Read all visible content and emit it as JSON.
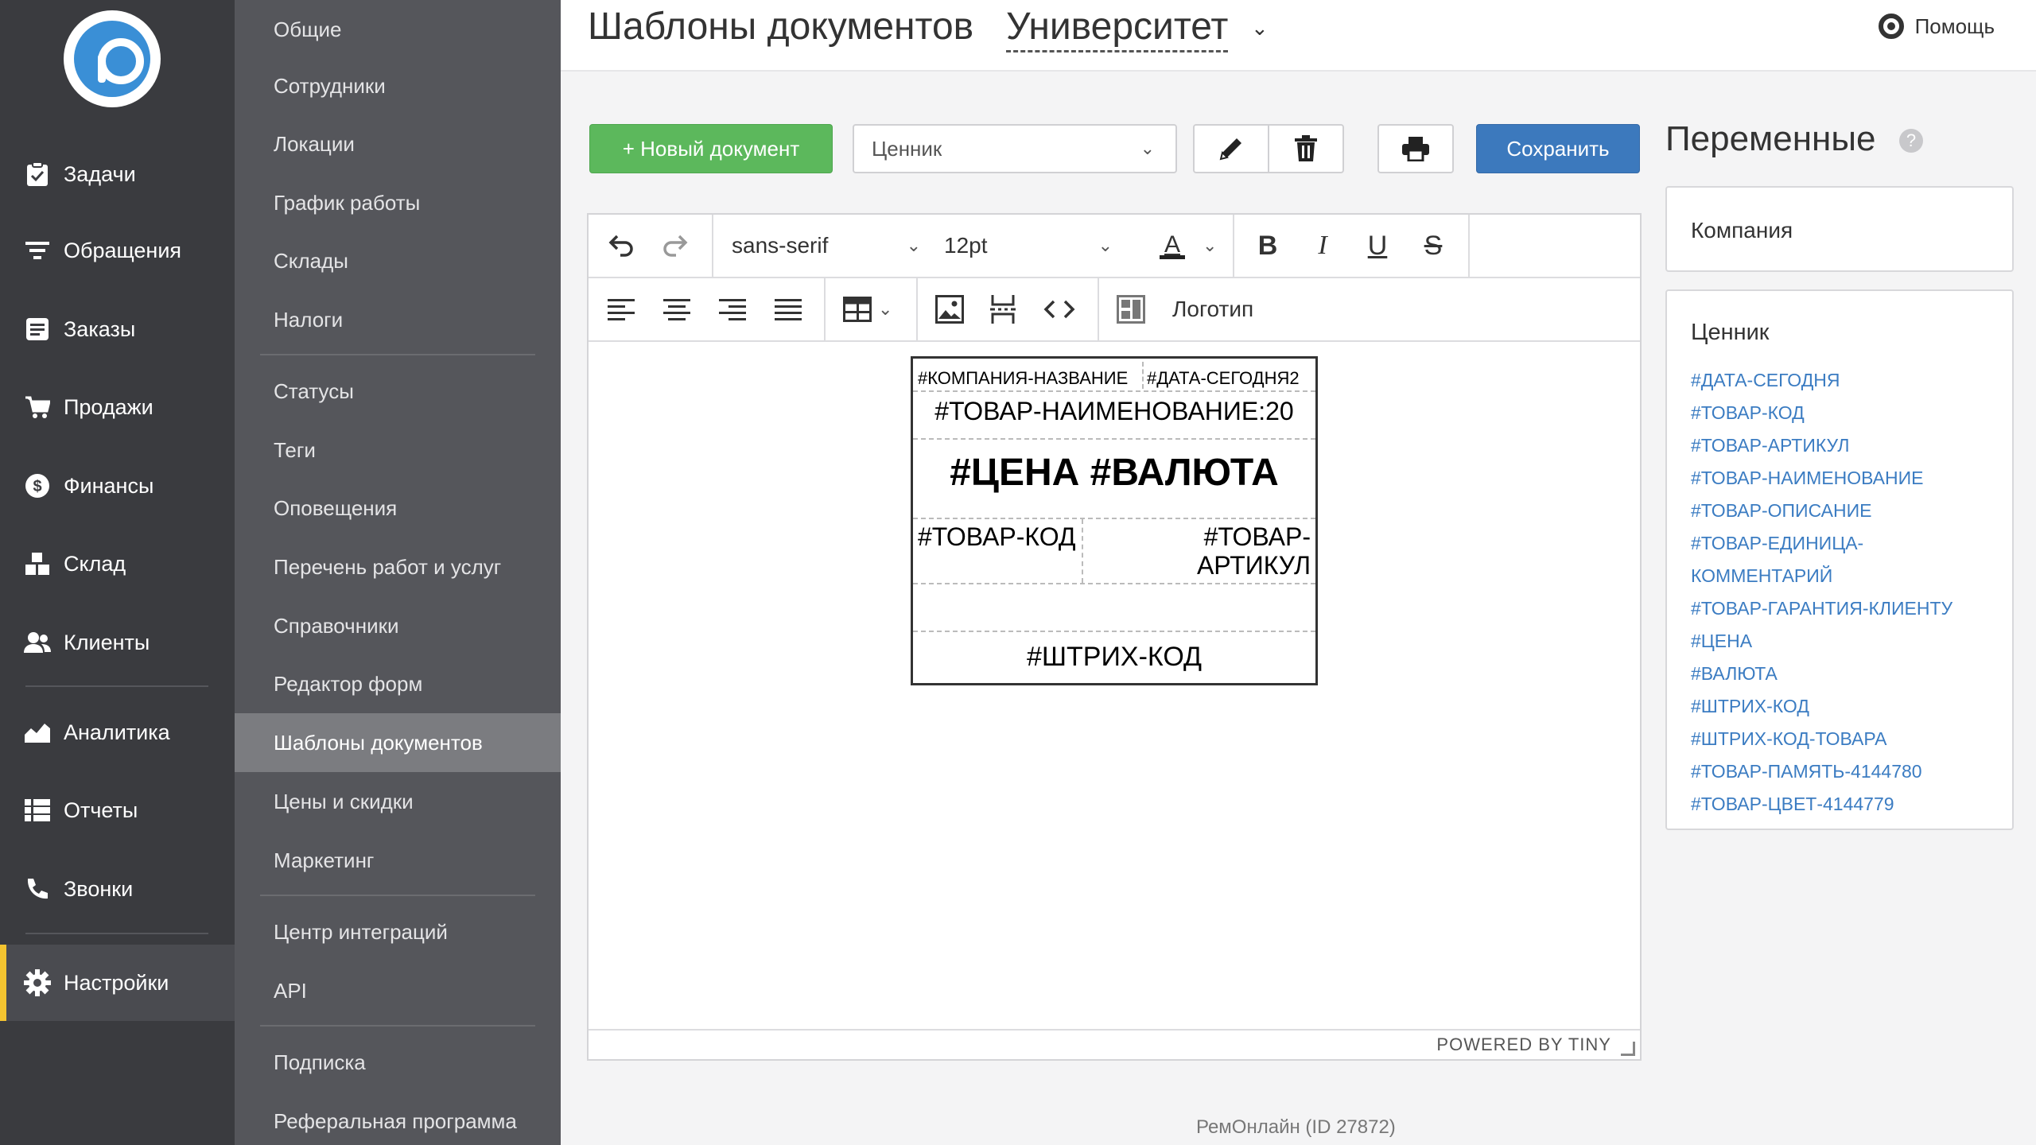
{
  "left_nav": {
    "items": [
      {
        "label": "Задачи",
        "icon": "tasks-icon"
      },
      {
        "label": "Обращения",
        "icon": "filter-icon"
      },
      {
        "label": "Заказы",
        "icon": "orders-icon"
      },
      {
        "label": "Продажи",
        "icon": "cart-icon"
      },
      {
        "label": "Финансы",
        "icon": "dollar-icon"
      },
      {
        "label": "Склад",
        "icon": "boxes-icon"
      },
      {
        "label": "Клиенты",
        "icon": "users-icon"
      },
      {
        "label": "Аналитика",
        "icon": "chart-icon"
      },
      {
        "label": "Отчеты",
        "icon": "list-icon"
      },
      {
        "label": "Звонки",
        "icon": "phone-icon"
      },
      {
        "label": "Настройки",
        "icon": "gear-icon"
      }
    ],
    "active": "Настройки",
    "accent_color": "#f4c430"
  },
  "settings_menu": {
    "items": [
      "Общие",
      "Сотрудники",
      "Локации",
      "График работы",
      "Склады",
      "Налоги",
      "Статусы",
      "Теги",
      "Оповещения",
      "Перечень работ и услуг",
      "Справочники",
      "Редактор форм",
      "Шаблоны документов",
      "Цены и скидки",
      "Маркетинг",
      "Центр интеграций",
      "API",
      "Подписка",
      "Реферальная программа"
    ],
    "active": "Шаблоны документов"
  },
  "header": {
    "title": "Шаблоны документов",
    "org": "Университет",
    "help": "Помощь"
  },
  "toolbar": {
    "new_label": "+ Новый документ",
    "template_value": "Ценник",
    "save_label": "Сохранить"
  },
  "editor": {
    "font_family": "sans-serif",
    "font_size": "12pt",
    "logo_label": "Логотип",
    "powered_by": "POWERED BY TINY"
  },
  "tag": {
    "company": "#КОМПАНИЯ-НАЗВАНИЕ",
    "date": "#ДАТА-СЕГОДНЯ2",
    "name": "#ТОВАР-НАИМЕНОВАНИЕ:20",
    "price": "#ЦЕНА #ВАЛЮТА",
    "code": "#ТОВАР-КОД",
    "article": "#ТОВАР-АРТИКУЛ",
    "barcode": "#ШТРИХ-КОД"
  },
  "variables": {
    "title": "Переменные",
    "company_group": "Компания",
    "tag_group": "Ценник",
    "tag_vars": [
      "#ДАТА-СЕГОДНЯ",
      "#ТОВАР-КОД",
      "#ТОВАР-АРТИКУЛ",
      "#ТОВАР-НАИМЕНОВАНИЕ",
      "#ТОВАР-ОПИСАНИЕ",
      "#ТОВАР-ЕДИНИЦА-",
      "КОММЕНТАРИЙ",
      "#ТОВАР-ГАРАНТИЯ-КЛИЕНТУ",
      "#ЦЕНА",
      "#ВАЛЮТА",
      "#ШТРИХ-КОД",
      "#ШТРИХ-КОД-ТОВАРА",
      "#ТОВАР-ПАМЯТЬ-4144780",
      "#ТОВАР-ЦВЕТ-4144779"
    ],
    "link_color": "#3b7cc2"
  },
  "footer": "РемОнлайн (ID 27872)"
}
